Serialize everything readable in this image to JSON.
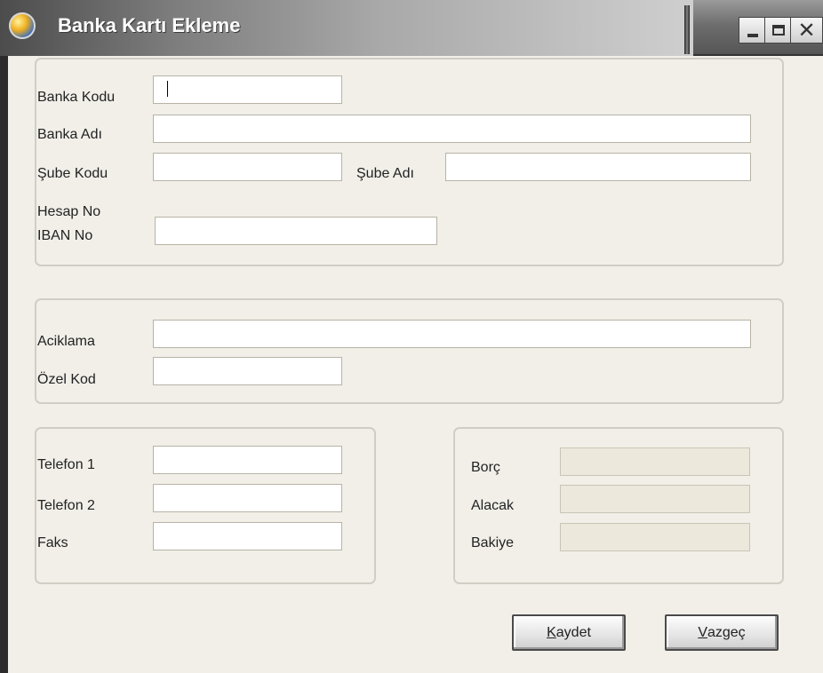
{
  "window": {
    "title": "Banka Kartı Ekleme",
    "close_glyph": "✕"
  },
  "bank_info": {
    "bank_code_label": "Banka Kodu",
    "bank_code_value": "",
    "bank_name_label": "Banka Adı",
    "bank_name_value": "",
    "branch_code_label": "Şube Kodu",
    "branch_code_value": "",
    "branch_name_label": "Şube Adı",
    "branch_name_value": "",
    "account_no_label": "Hesap No",
    "iban_label": "IBAN No",
    "account_value": ""
  },
  "description": {
    "description_label": "Aciklama",
    "description_value": "",
    "special_code_label": "Özel Kod",
    "special_code_value": ""
  },
  "contact": {
    "phone1_label": "Telefon 1",
    "phone1_value": "",
    "phone2_label": "Telefon 2",
    "phone2_value": "",
    "fax_label": "Faks",
    "fax_value": ""
  },
  "balance": {
    "debit_label": "Borç",
    "debit_value": "",
    "credit_label": "Alacak",
    "credit_value": "",
    "balance_label": "Bakiye",
    "balance_value": ""
  },
  "buttons": {
    "save_mnemonic": "K",
    "save_rest": "aydet",
    "cancel_mnemonic": "V",
    "cancel_rest": "azgeç"
  },
  "colors": {
    "readonly_fill": "#ece9dc",
    "dialog_background": "#f1efe8"
  },
  "icons": {
    "app": "globe-icon",
    "minimize": "minimize-icon",
    "maximize": "maximize-icon",
    "close": "close-icon"
  }
}
